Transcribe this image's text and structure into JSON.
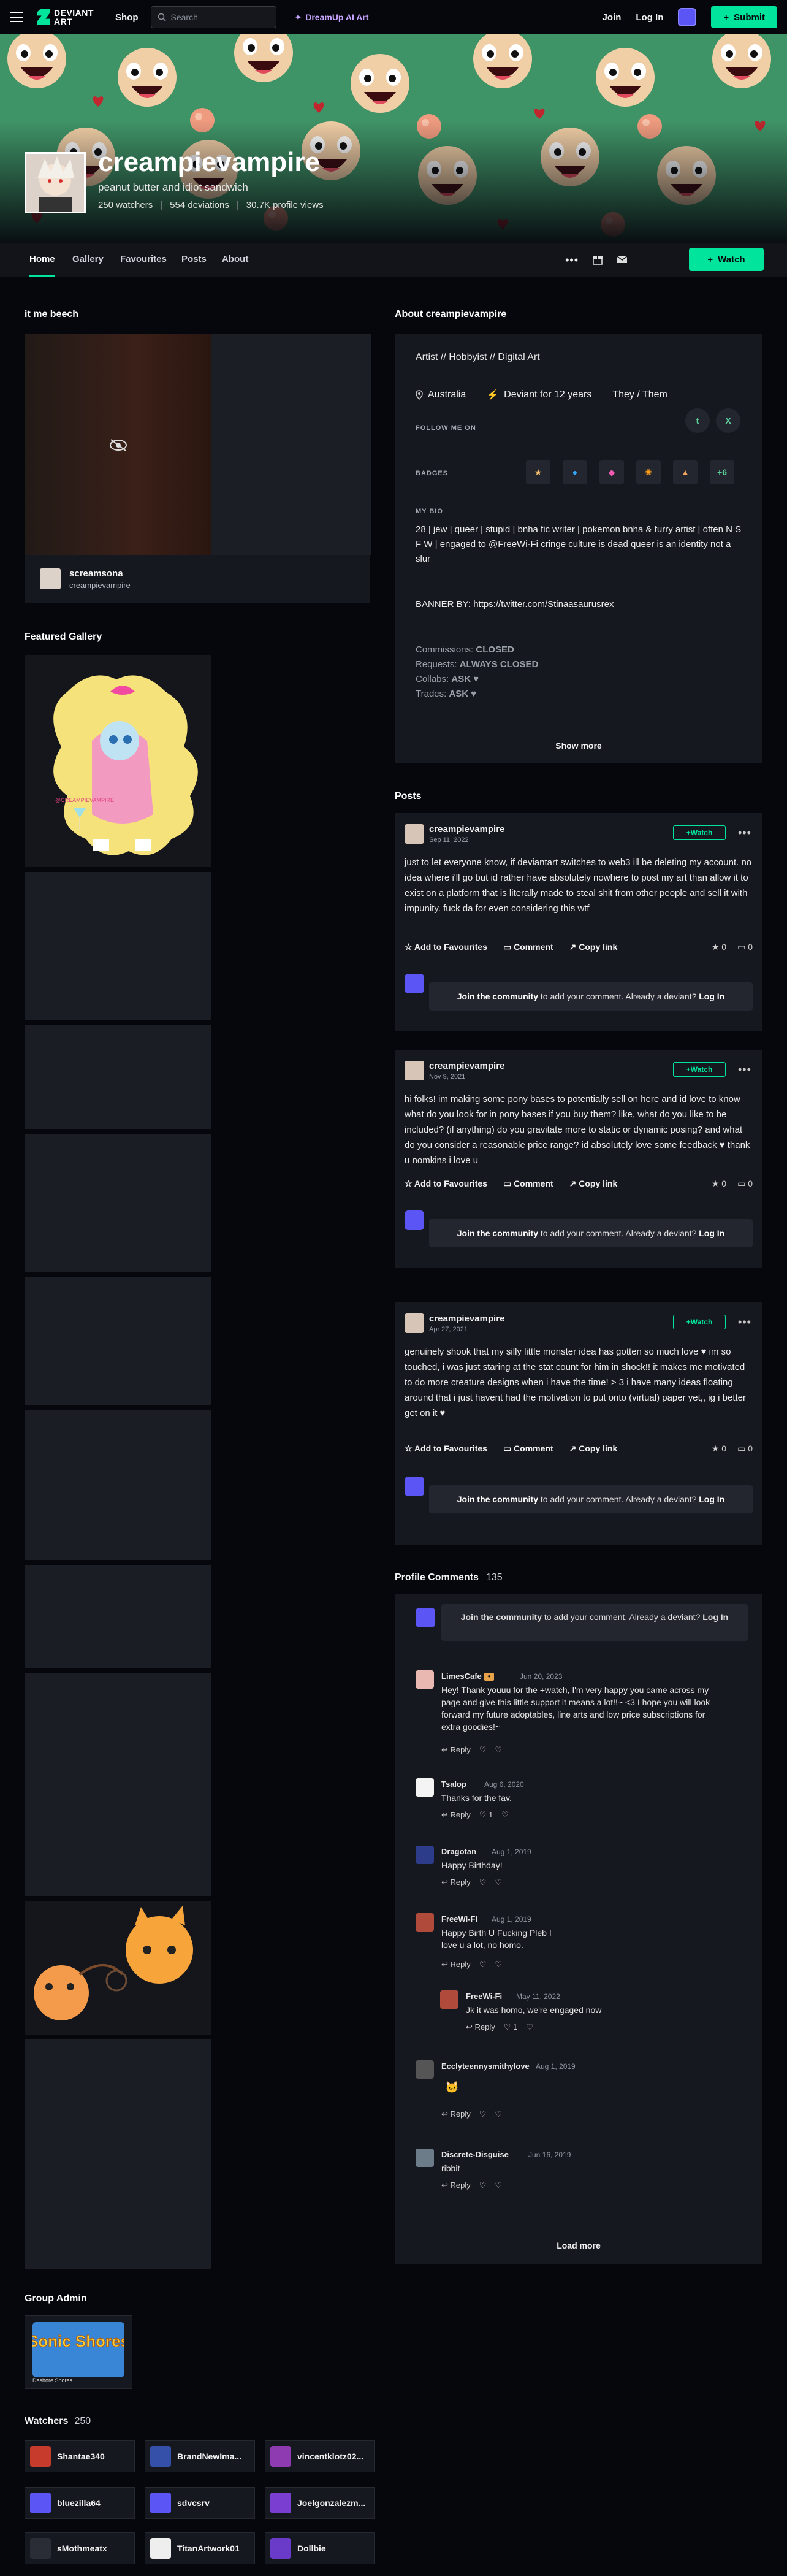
{
  "header": {
    "logo": "DEVIANT ART",
    "shop": "Shop",
    "search_placeholder": "Search",
    "dreamup": "DreamUp AI Art",
    "join": "Join",
    "login": "Log In",
    "submit": "Submit"
  },
  "profile": {
    "username": "creampievampire",
    "tagline": "peanut butter and idiot sandwich",
    "watchers": "250 watchers",
    "deviations": "554 deviations",
    "views": "30.7K profile views"
  },
  "tabs": [
    "Home",
    "Gallery",
    "Favourites",
    "Posts",
    "About"
  ],
  "watch_label": "Watch",
  "itmebeech": {
    "title": "it me beech",
    "deviation_title": "screamsona",
    "deviation_user": "creampievampire"
  },
  "featured": {
    "title": "Featured Gallery",
    "art_watermark": "@CREAMPIEVAMPIRE"
  },
  "about": {
    "title": "About creampievampire",
    "tags": "Artist // Hobbyist // Digital Art",
    "location": "Australia",
    "deviant_for": "Deviant for 12 years",
    "pronouns": "They / Them",
    "follow_label": "FOLLOW ME ON",
    "socials": [
      "t",
      "X"
    ],
    "badges_label": "BADGES",
    "badges_more": "+6",
    "bio_label": "MY BIO",
    "bio_line1": "28 | jew | queer | stupid | bnha fic writer | pokemon bnha & furry artist | often N S F W | engaged to",
    "bio_link": "@FreeWi-Fi",
    "bio_line2": "cringe culture is dead queer is an identity not a slur",
    "banner_by": "BANNER BY:",
    "banner_link": "https://twitter.com/Stinaasaurusrex",
    "commissions": "Commissions:",
    "commissions_val": "CLOSED",
    "requests": "Requests:",
    "requests_val": "ALWAYS CLOSED",
    "collabs": "Collabs:",
    "collabs_val": "ASK ♥",
    "trades": "Trades:",
    "trades_val": "ASK ♥",
    "show_more": "Show more"
  },
  "posts_title": "Posts",
  "posts": [
    {
      "user": "creampievampire",
      "date": "Sep 11, 2022",
      "text": "just to let everyone know, if deviantart switches to web3 ill be deleting my account. no idea where i'll go but id rather have absolutely nowhere to post my art than allow it to exist on a platform that is literally made to steal shit from other people and sell it with impunity. fuck da for even considering this wtf",
      "favs": "0",
      "comments": "0"
    },
    {
      "user": "creampievampire",
      "date": "Nov 9, 2021",
      "text": "hi folks! im making some pony bases to potentially sell on here and id love to know what do you look for in pony bases if you buy them? like, what do you like to be included? (if anything) do you gravitate more to static or dynamic posing? and what do you consider a reasonable price range? id absolutely love some feedback ♥ thank u nomkins i love u",
      "favs": "0",
      "comments": "0"
    },
    {
      "user": "creampievampire",
      "date": "Apr 27, 2021",
      "text": "genuinely shook that my silly little monster idea has gotten so much love ♥ im so touched, i was just staring at the stat count for him in shock!! it makes me motivated to do more creature designs when i have the time! > 3 i have many ideas floating around that i just havent had the motivation to put onto (virtual) paper yet,, ig i better get on it ♥",
      "favs": "0",
      "comments": "0"
    }
  ],
  "post_actions": {
    "fav": "Add to Favourites",
    "comment": "Comment",
    "copy": "Copy link",
    "watch": "Watch"
  },
  "join_prompt": {
    "join": "Join the community",
    "middle": "to add your comment. Already a deviant?",
    "login": "Log In"
  },
  "profile_comments": {
    "title": "Profile Comments",
    "count": "135",
    "load_more": "Load more",
    "reply": "Reply",
    "items": [
      {
        "user": "LimesCafe",
        "date": "Jun 20, 2023",
        "text": "Hey! Thank youuu for the +watch, I'm very happy you came across my page and give this little support it means a lot!!~ <3  I hope you will look forward my future adoptables, line arts and low price subscriptions for extra goodies!~",
        "likes": ""
      },
      {
        "user": "Tsalop",
        "date": "Aug 6, 2020",
        "text": "Thanks for the fav.",
        "likes": "1"
      },
      {
        "user": "Dragotan",
        "date": "Aug 1, 2019",
        "text": "Happy Birthday!",
        "likes": ""
      },
      {
        "user": "FreeWi-Fi",
        "date": "Aug 1, 2019",
        "text": "Happy Birth U Fucking Pleb I love u a lot, no homo.",
        "likes": ""
      },
      {
        "user": "FreeWi-Fi",
        "date": "May 11, 2022",
        "text": "Jk it was homo, we're engaged now",
        "likes": "1"
      },
      {
        "user": "Ecclyteennysmithylove",
        "date": "Aug 1, 2019",
        "text": "",
        "likes": ""
      },
      {
        "user": "Discrete-Disguise",
        "date": "Jun 16, 2019",
        "text": "ribbit",
        "likes": ""
      }
    ]
  },
  "group_admin": {
    "title": "Group Admin",
    "group": "Sonic Shores",
    "caption": "Deshore Shores"
  },
  "watchers": {
    "title": "Watchers",
    "count": "250",
    "items": [
      "Shantae340",
      "BrandNewIma...",
      "vincentklotz02...",
      "bluezilla64",
      "sdvcsrv",
      "Joelgonzalezm...",
      "sMothmeatx",
      "TitanArtwork01",
      "Dollbie"
    ]
  },
  "colors": {
    "accent": "#00e59b",
    "bg": "#06070d",
    "panel": "#16181f"
  }
}
